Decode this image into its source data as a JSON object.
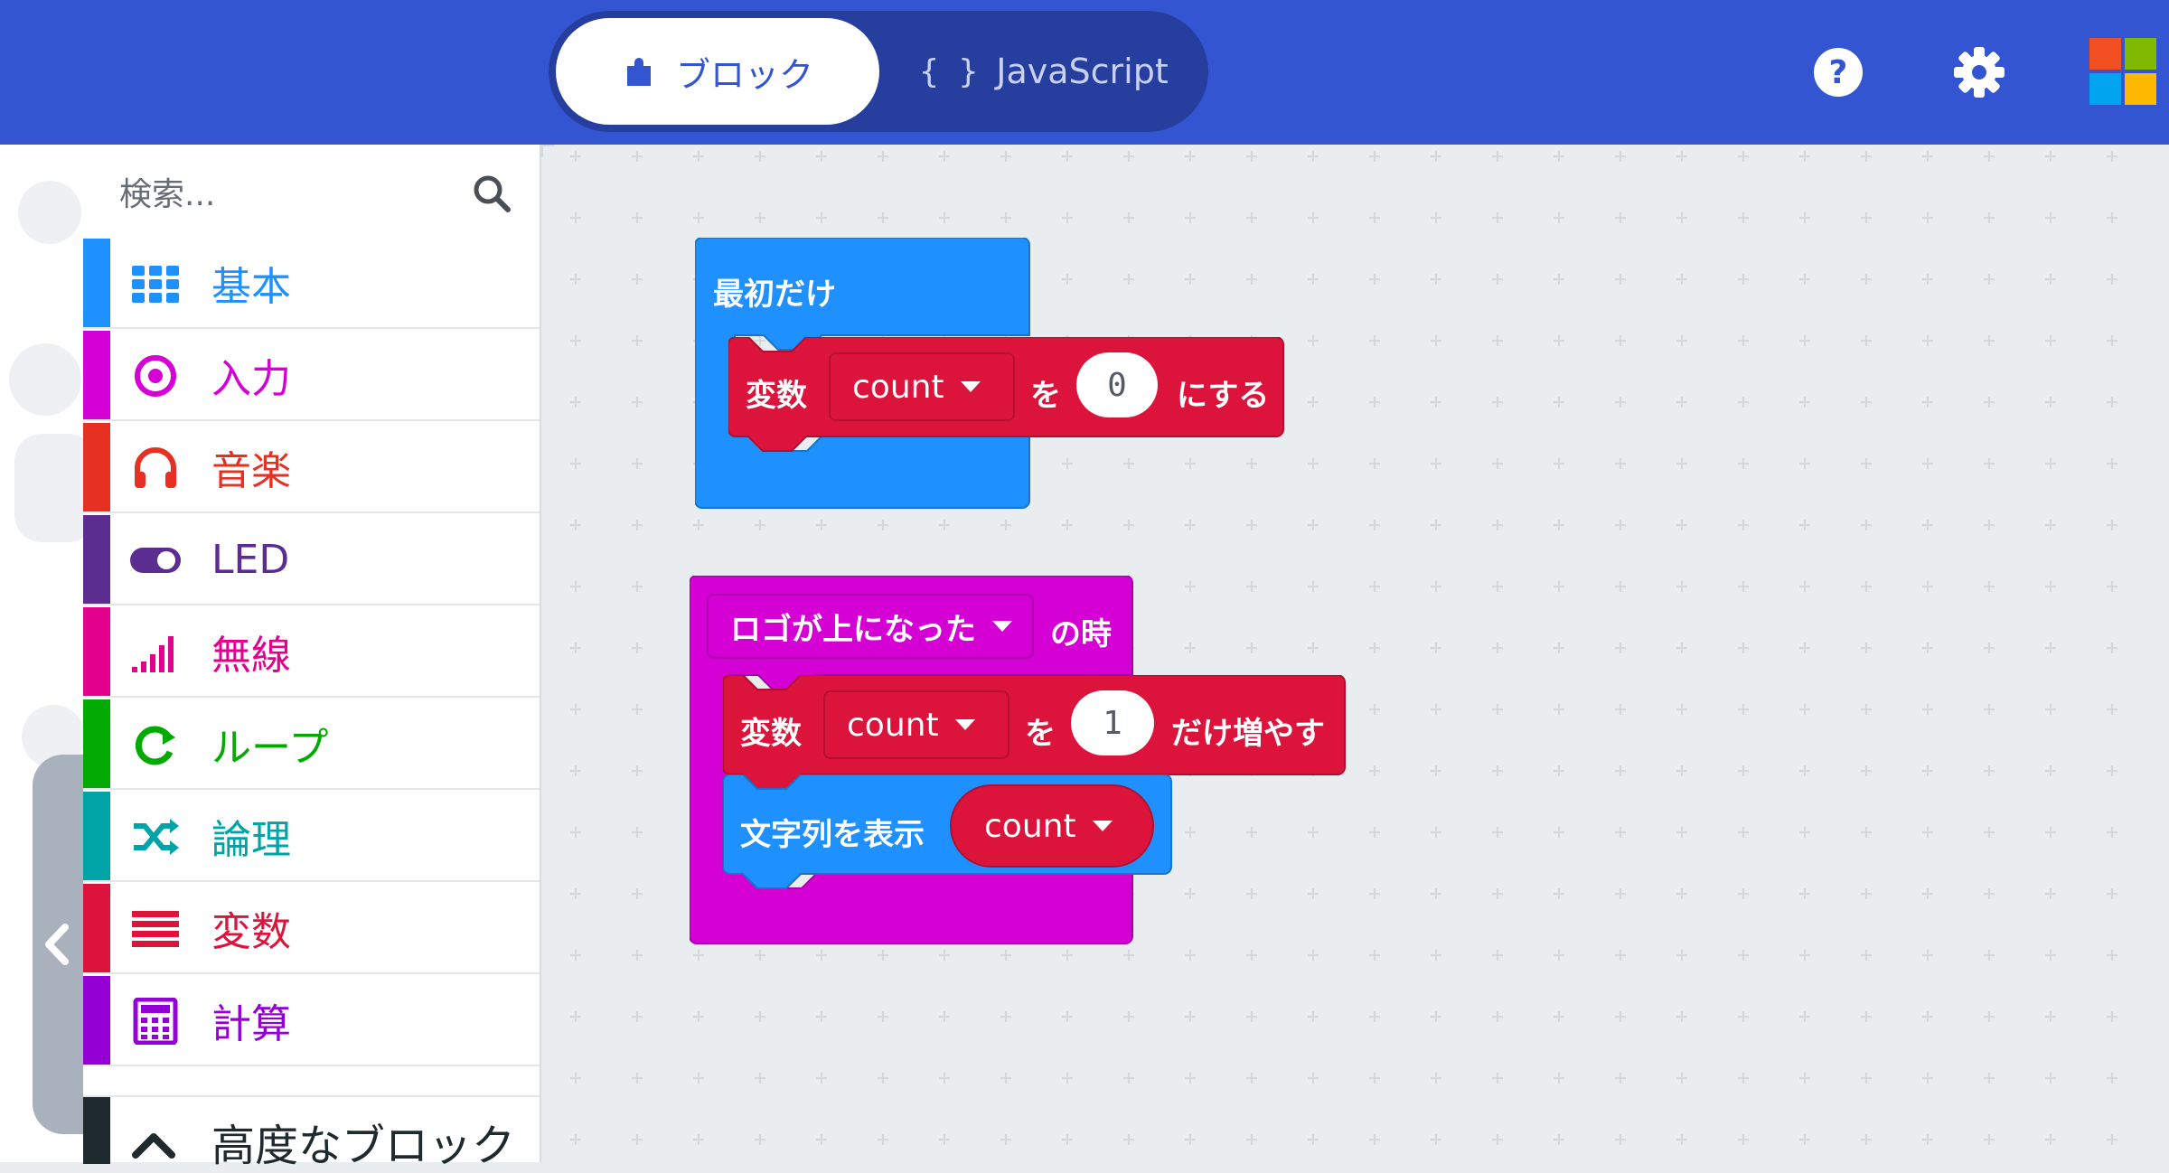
{
  "header": {
    "tabs": [
      {
        "label": "ブロック",
        "icon": "puzzle-icon",
        "active": true
      },
      {
        "label": "JavaScript",
        "icon": "braces-icon",
        "prefix": "{ }",
        "active": false
      }
    ],
    "icons": [
      "help-icon",
      "gear-icon",
      "microsoft-logo"
    ],
    "colors": {
      "header_bg": "#3455d1",
      "toggle_bg": "#263e9e"
    }
  },
  "toolbox": {
    "search_placeholder": "検索...",
    "categories": [
      {
        "label": "基本",
        "icon": "grid-icon",
        "color": "#1e90ff"
      },
      {
        "label": "入力",
        "icon": "target-icon",
        "color": "#d400d4"
      },
      {
        "label": "音楽",
        "icon": "headphones-icon",
        "color": "#e63022"
      },
      {
        "label": "LED",
        "icon": "toggle-icon",
        "color": "#5c2d91"
      },
      {
        "label": "無線",
        "icon": "signal-icon",
        "color": "#e3008c"
      },
      {
        "label": "ループ",
        "icon": "refresh-icon",
        "color": "#00aa00"
      },
      {
        "label": "論理",
        "icon": "shuffle-icon",
        "color": "#00a4a6"
      },
      {
        "label": "変数",
        "icon": "list-icon",
        "color": "#dc143c"
      },
      {
        "label": "計算",
        "icon": "calculator-icon",
        "color": "#9400d3"
      }
    ],
    "advanced_label": "高度なブロック"
  },
  "workspace": {
    "on_start": {
      "label": "最初だけ",
      "set_block": {
        "prefix": "変数",
        "variable": "count",
        "particle": "を",
        "value": "0",
        "suffix": "にする"
      }
    },
    "on_gesture": {
      "gesture": "ロゴが上になった",
      "suffix": "の時",
      "change_block": {
        "prefix": "変数",
        "variable": "count",
        "particle": "を",
        "value": "1",
        "suffix": "だけ増やす"
      },
      "show_block": {
        "label": "文字列を表示",
        "variable": "count"
      }
    },
    "colors": {
      "basic": "#1e90ff",
      "input": "#d400d4",
      "variables": "#dc143c"
    }
  }
}
